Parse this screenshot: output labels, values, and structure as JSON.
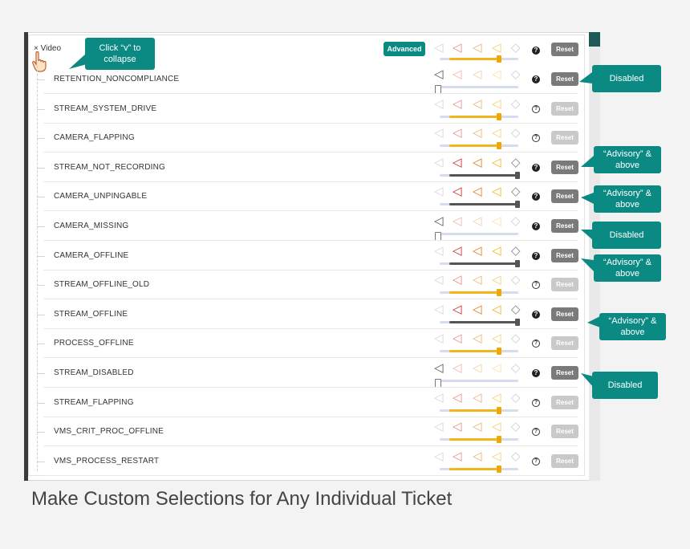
{
  "header": {
    "collapse_label": "× Video",
    "advanced_label": "Advanced",
    "reset_label": "Reset",
    "help_symbol": "?"
  },
  "tooltip": {
    "text": "Click “v” to collapse"
  },
  "rows": [
    {
      "name": "RETENTION_NONCOMPLIANCE",
      "state": "disabled",
      "reset_active": true
    },
    {
      "name": "STREAM_SYSTEM_DRIVE",
      "state": "default",
      "reset_active": false
    },
    {
      "name": "CAMERA_FLAPPING",
      "state": "default",
      "reset_active": false
    },
    {
      "name": "STREAM_NOT_RECORDING",
      "state": "advisory",
      "reset_active": true
    },
    {
      "name": "CAMERA_UNPINGABLE",
      "state": "advisory",
      "reset_active": true
    },
    {
      "name": "CAMERA_MISSING",
      "state": "disabled",
      "reset_active": true
    },
    {
      "name": "CAMERA_OFFLINE",
      "state": "advisory",
      "reset_active": true
    },
    {
      "name": "STREAM_OFFLINE_OLD",
      "state": "default",
      "reset_active": false
    },
    {
      "name": "STREAM_OFFLINE",
      "state": "advisory",
      "reset_active": true
    },
    {
      "name": "PROCESS_OFFLINE",
      "state": "default",
      "reset_active": false
    },
    {
      "name": "STREAM_DISABLED",
      "state": "disabled",
      "reset_active": true
    },
    {
      "name": "STREAM_FLAPPING",
      "state": "default",
      "reset_active": false
    },
    {
      "name": "VMS_CRIT_PROC_OFFLINE",
      "state": "default",
      "reset_active": false
    },
    {
      "name": "VMS_PROCESS_RESTART",
      "state": "default",
      "reset_active": false
    }
  ],
  "callouts": {
    "disabled_1": "Disabled",
    "advisory_1": "“Advisory” & above",
    "advisory_2": "“Advisory” & above",
    "disabled_2": "Disabled",
    "advisory_3": "“Advisory” & above",
    "advisory_4": "“Advisory” & above",
    "disabled_3": "Disabled"
  },
  "caption": "Make Custom Selections for Any Individual Ticket",
  "colors": {
    "teal": "#0b8a84",
    "critical_red": "#d0232b",
    "orange": "#e07a14",
    "yellow": "#f2b51e",
    "grey": "#888888"
  }
}
